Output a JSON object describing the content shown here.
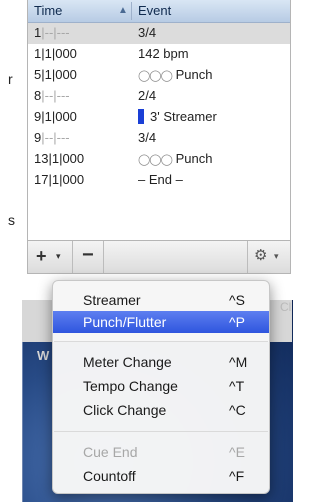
{
  "left_edge": {
    "letter_1": "r",
    "letter_2": "s"
  },
  "background": {
    "obscured_label": "W",
    "clipped_label": "Cl"
  },
  "list": {
    "columns": {
      "time": "Time",
      "event": "Event"
    },
    "rows": [
      {
        "time_main": "1",
        "time_rest": "|--|---",
        "event": "3/4",
        "kind": "meter",
        "selected": true
      },
      {
        "time_main": "1|1|000",
        "time_rest": "",
        "event": "142 bpm",
        "kind": "tempo",
        "selected": false
      },
      {
        "time_main": "5|1|000",
        "time_rest": "",
        "event": "Punch",
        "kind": "punch",
        "selected": false
      },
      {
        "time_main": "8",
        "time_rest": "|--|---",
        "event": "2/4",
        "kind": "meter",
        "selected": false
      },
      {
        "time_main": "9|1|000",
        "time_rest": "",
        "event": "3' Streamer",
        "kind": "streamer",
        "selected": false
      },
      {
        "time_main": "9",
        "time_rest": "|--|---",
        "event": "3/4",
        "kind": "meter",
        "selected": false
      },
      {
        "time_main": "13|1|000",
        "time_rest": "",
        "event": "Punch",
        "kind": "punch",
        "selected": false
      },
      {
        "time_main": "17|1|000",
        "time_rest": "",
        "event": "– End –",
        "kind": "end",
        "selected": false
      }
    ],
    "punch_icon": "◯◯◯"
  },
  "toolbar": {
    "add": "+",
    "add_caret": "▾",
    "remove": "−",
    "gear": "⚙",
    "gear_caret": "▾"
  },
  "menu": {
    "items": [
      {
        "label": "Streamer",
        "shortcut": "^S",
        "state": "normal"
      },
      {
        "label": "Punch/Flutter",
        "shortcut": "^P",
        "state": "active"
      },
      {
        "label": "Meter Change",
        "shortcut": "^M",
        "state": "normal"
      },
      {
        "label": "Tempo Change",
        "shortcut": "^T",
        "state": "normal"
      },
      {
        "label": "Click Change",
        "shortcut": "^C",
        "state": "normal"
      },
      {
        "label": "Cue End",
        "shortcut": "^E",
        "state": "disabled"
      },
      {
        "label": "Countoff",
        "shortcut": "^F",
        "state": "normal"
      }
    ]
  },
  "colors": {
    "highlight": "#3e63e6",
    "streamer": "#1a3fd6",
    "selected_row": "#dcdcdc"
  }
}
